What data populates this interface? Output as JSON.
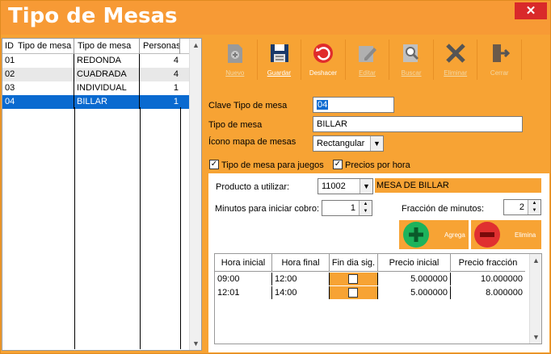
{
  "window": {
    "title": "Tipo de Mesas",
    "close_label": "✕"
  },
  "left_table": {
    "headers": [
      "ID",
      "Tipo de mesa",
      "Tipo de mesa",
      "Personas"
    ],
    "rows": [
      {
        "id": "01",
        "tipo": "REDONDA",
        "personas": "4"
      },
      {
        "id": "02",
        "tipo": "CUADRADA",
        "personas": "4"
      },
      {
        "id": "03",
        "tipo": "INDIVIDUAL",
        "personas": "1"
      },
      {
        "id": "04",
        "tipo": "BILLAR",
        "personas": "1"
      }
    ],
    "selected_index": 3
  },
  "toolbar": {
    "nuevo": "Nuevo",
    "guardar": "Guardar",
    "deshacer": "Deshacer",
    "editar": "Editar",
    "buscar": "Buscar",
    "eliminar": "Eliminar",
    "cerrar": "Cerrar"
  },
  "form": {
    "clave_label": "Clave Tipo de mesa",
    "clave_value": "04",
    "tipo_label": "Tipo de mesa",
    "tipo_value": "BILLAR",
    "icono_label": "Ícono mapa de mesas",
    "icono_value": "Rectangular",
    "chk_juegos_label": "Tipo de mesa para juegos",
    "chk_precios_label": "Precios por hora"
  },
  "panel": {
    "producto_label": "Producto a utilizar:",
    "producto_value": "11002",
    "producto_desc": "MESA DE BILLAR",
    "minutos_label": "Minutos para iniciar cobro:",
    "minutos_value": "1",
    "fraccion_label": "Fracción de minutos:",
    "fraccion_value": "2",
    "agrega_label": "Agrega",
    "elimina_label": "Elimina"
  },
  "price_table": {
    "headers": [
      "Hora inicial",
      "Hora final",
      "Fin dia sig.",
      "Precio inicial",
      "Precio fracción"
    ],
    "rows": [
      {
        "hora_inicial": "09:00",
        "hora_final": "12:00",
        "precio_inicial": "5.000000",
        "precio_fraccion": "10.000000"
      },
      {
        "hora_inicial": "12:01",
        "hora_final": "14:00",
        "precio_inicial": "5.000000",
        "precio_fraccion": "8.000000"
      }
    ]
  },
  "colors": {
    "accent": "#f7a334",
    "selection": "#0a6ad0",
    "close": "#d9292a"
  }
}
